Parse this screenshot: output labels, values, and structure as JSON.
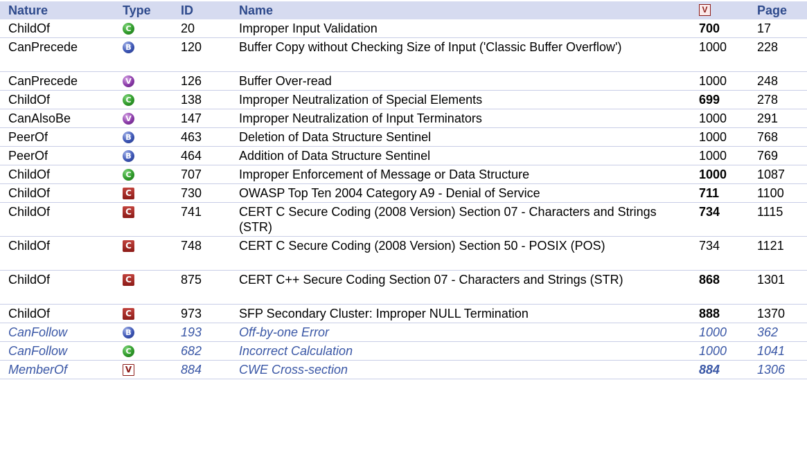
{
  "header": {
    "nature": "Nature",
    "type": "Type",
    "id": "ID",
    "name": "Name",
    "view_icon": "view-icon",
    "view_glyph": "V",
    "page": "Page"
  },
  "icon_glyphs": {
    "class": "C",
    "base": "B",
    "variant": "V",
    "category": "C",
    "view": "V"
  },
  "colors": {
    "header_bg": "#d6dbf0",
    "header_text": "#2e4a8c",
    "inferred_text": "#3a57a6",
    "class_icon": "#2f9a2a",
    "base_icon": "#3c55b4",
    "variant_icon": "#8a3aa8",
    "category_icon": "#a52a25"
  },
  "rows": [
    {
      "nature": "ChildOf",
      "type": "class",
      "id": "20",
      "name": "Improper Input Validation",
      "view": "700",
      "view_bold": true,
      "page": "17",
      "inferred": false
    },
    {
      "nature": "CanPrecede",
      "type": "base",
      "id": "120",
      "name": "Buffer Copy without Checking Size of Input ('Classic Buffer Overflow')",
      "view": "1000",
      "view_bold": false,
      "page": "228",
      "inferred": false
    },
    {
      "nature": "CanPrecede",
      "type": "variant",
      "id": "126",
      "name": "Buffer Over-read",
      "view": "1000",
      "view_bold": false,
      "page": "248",
      "inferred": false
    },
    {
      "nature": "ChildOf",
      "type": "class",
      "id": "138",
      "name": "Improper Neutralization of Special Elements",
      "view": "699",
      "view_bold": true,
      "page": "278",
      "inferred": false
    },
    {
      "nature": "CanAlsoBe",
      "type": "variant",
      "id": "147",
      "name": "Improper Neutralization of Input Terminators",
      "view": "1000",
      "view_bold": false,
      "page": "291",
      "inferred": false
    },
    {
      "nature": "PeerOf",
      "type": "base",
      "id": "463",
      "name": "Deletion of Data Structure Sentinel",
      "view": "1000",
      "view_bold": false,
      "page": "768",
      "inferred": false
    },
    {
      "nature": "PeerOf",
      "type": "base",
      "id": "464",
      "name": "Addition of Data Structure Sentinel",
      "view": "1000",
      "view_bold": false,
      "page": "769",
      "inferred": false
    },
    {
      "nature": "ChildOf",
      "type": "class",
      "id": "707",
      "name": "Improper Enforcement of Message or Data Structure",
      "view": "1000",
      "view_bold": true,
      "page": "1087",
      "inferred": false
    },
    {
      "nature": "ChildOf",
      "type": "category",
      "id": "730",
      "name": "OWASP Top Ten 2004 Category A9 - Denial of Service",
      "view": "711",
      "view_bold": true,
      "page": "1100",
      "inferred": false
    },
    {
      "nature": "ChildOf",
      "type": "category",
      "id": "741",
      "name": "CERT C Secure Coding (2008 Version) Section 07 - Characters and Strings (STR)",
      "view": "734",
      "view_bold": true,
      "page": "1115",
      "inferred": false
    },
    {
      "nature": "ChildOf",
      "type": "category",
      "id": "748",
      "name": "CERT C Secure Coding (2008 Version) Section 50 - POSIX (POS)",
      "view": "734",
      "view_bold": false,
      "page": "1121",
      "inferred": false
    },
    {
      "nature": "ChildOf",
      "type": "category",
      "id": "875",
      "name": "CERT C++ Secure Coding Section 07 - Characters and Strings (STR)",
      "view": "868",
      "view_bold": true,
      "page": "1301",
      "inferred": false
    },
    {
      "nature": "ChildOf",
      "type": "category",
      "id": "973",
      "name": "SFP Secondary Cluster: Improper NULL Termination",
      "view": "888",
      "view_bold": true,
      "page": "1370",
      "inferred": false
    },
    {
      "nature": "CanFollow",
      "type": "base",
      "id": "193",
      "name": "Off-by-one Error",
      "view": "1000",
      "view_bold": false,
      "page": "362",
      "inferred": true
    },
    {
      "nature": "CanFollow",
      "type": "class",
      "id": "682",
      "name": "Incorrect Calculation",
      "view": "1000",
      "view_bold": false,
      "page": "1041",
      "inferred": true
    },
    {
      "nature": "MemberOf",
      "type": "view",
      "id": "884",
      "name": "CWE Cross-section",
      "view": "884",
      "view_bold": true,
      "page": "1306",
      "inferred": true
    }
  ]
}
